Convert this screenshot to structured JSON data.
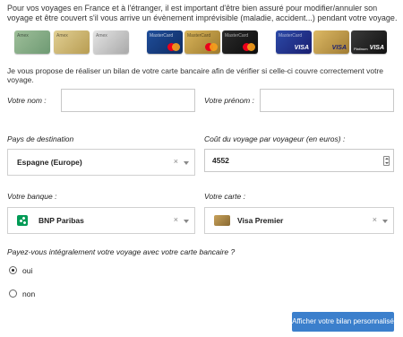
{
  "intro": "Pour vos voyages en France et à l'étranger, il est important d'être bien assuré pour modifier/annuler son voyage et être couvert s'il vous arrive un évènement imprévisible (maladie, accident...) pendant votre voyage.",
  "cards": {
    "amex": [
      "Amex",
      "Amex",
      "Amex"
    ],
    "mastercard": [
      "MasterCard",
      "MasterCard",
      "MasterCard",
      "MasterCard"
    ],
    "visa": [
      "VISA",
      "VISA",
      "VISA"
    ],
    "platinum": "Platinum"
  },
  "subtitle": "Je vous propose de réaliser un bilan de votre carte bancaire afin de vérifier si celle-ci couvre correctement votre voyage.",
  "form": {
    "nom_label": "Votre nom :",
    "prenom_label": "Votre prénom :",
    "nom_value": "",
    "prenom_value": "",
    "destination_label": "Pays de destination",
    "destination_value": "Espagne (Europe)",
    "cout_label": "Coût du voyage par voyageur (en euros) :",
    "cout_value": "4552",
    "banque_label": "Votre banque :",
    "banque_value": "BNP Paribas",
    "carte_label": "Votre carte :",
    "carte_value": "Visa Premier",
    "clear_symbol": "×",
    "question": "Payez-vous intégralement votre voyage avec votre carte bancaire ?",
    "option_oui": "oui",
    "option_non": "non",
    "selected_option": "oui"
  },
  "button_label": "Afficher votre bilan personnalisé",
  "colors": {
    "button": "#3b7fcc",
    "bnp_green": "#009a55",
    "mastercard_red": "#eb001b",
    "mastercard_orange": "#f79e1b",
    "visa_blue": "#1a1f71"
  }
}
